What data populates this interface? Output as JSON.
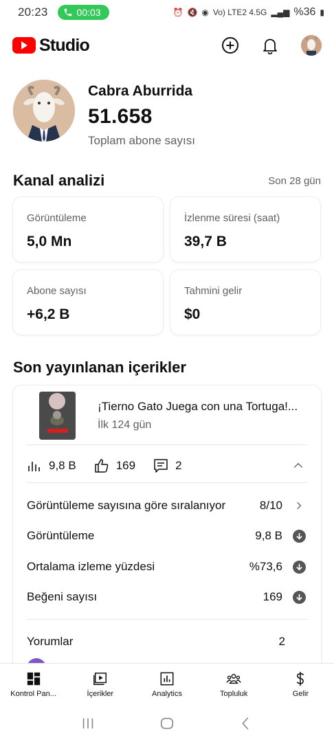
{
  "status_bar": {
    "time": "20:23",
    "call_timer": "00:03",
    "network": "Vo) LTE2 4.5G",
    "battery": "%36"
  },
  "app": {
    "logo_text": "Studio"
  },
  "channel": {
    "name": "Cabra Aburrida",
    "subscriber_count": "51.658",
    "subscriber_label": "Toplam abone sayısı"
  },
  "analytics": {
    "title": "Kanal analizi",
    "period": "Son 28 gün",
    "cards": [
      {
        "label": "Görüntüleme",
        "value": "5,0 Mn"
      },
      {
        "label": "İzlenme süresi (saat)",
        "value": "39,7 B"
      },
      {
        "label": "Abone sayısı",
        "value": "+6,2 B"
      },
      {
        "label": "Tahmini gelir",
        "value": "$0"
      }
    ]
  },
  "recent": {
    "title": "Son yayınlanan içerikler",
    "video": {
      "title": "¡Tierno Gato Juega con una Tortuga!...",
      "age": "İlk 124 gün",
      "thumb_badge": "SUSCRIBIRSE"
    },
    "stats": {
      "views": "9,8 B",
      "likes": "169",
      "comments": "2"
    },
    "ranking": {
      "label": "Görüntüleme sayısına göre sıralanıyor",
      "value": "8/10"
    },
    "metrics": [
      {
        "label": "Görüntüleme",
        "value": "9,8 B"
      },
      {
        "label": "Ortalama izleme yüzdesi",
        "value": "%73,6"
      },
      {
        "label": "Beğeni sayısı",
        "value": "169"
      }
    ],
    "comments_row": {
      "label": "Yorumlar",
      "value": "2"
    }
  },
  "bottom_nav": [
    {
      "label": "Kontrol Pan...",
      "icon": "dashboard-icon"
    },
    {
      "label": "İçerikler",
      "icon": "content-icon"
    },
    {
      "label": "Analytics",
      "icon": "analytics-icon"
    },
    {
      "label": "Topluluk",
      "icon": "community-icon"
    },
    {
      "label": "Gelir",
      "icon": "earn-icon"
    }
  ],
  "colors": {
    "brand_red": "#ff0000",
    "call_green": "#34c759",
    "text_secondary": "#606060"
  }
}
